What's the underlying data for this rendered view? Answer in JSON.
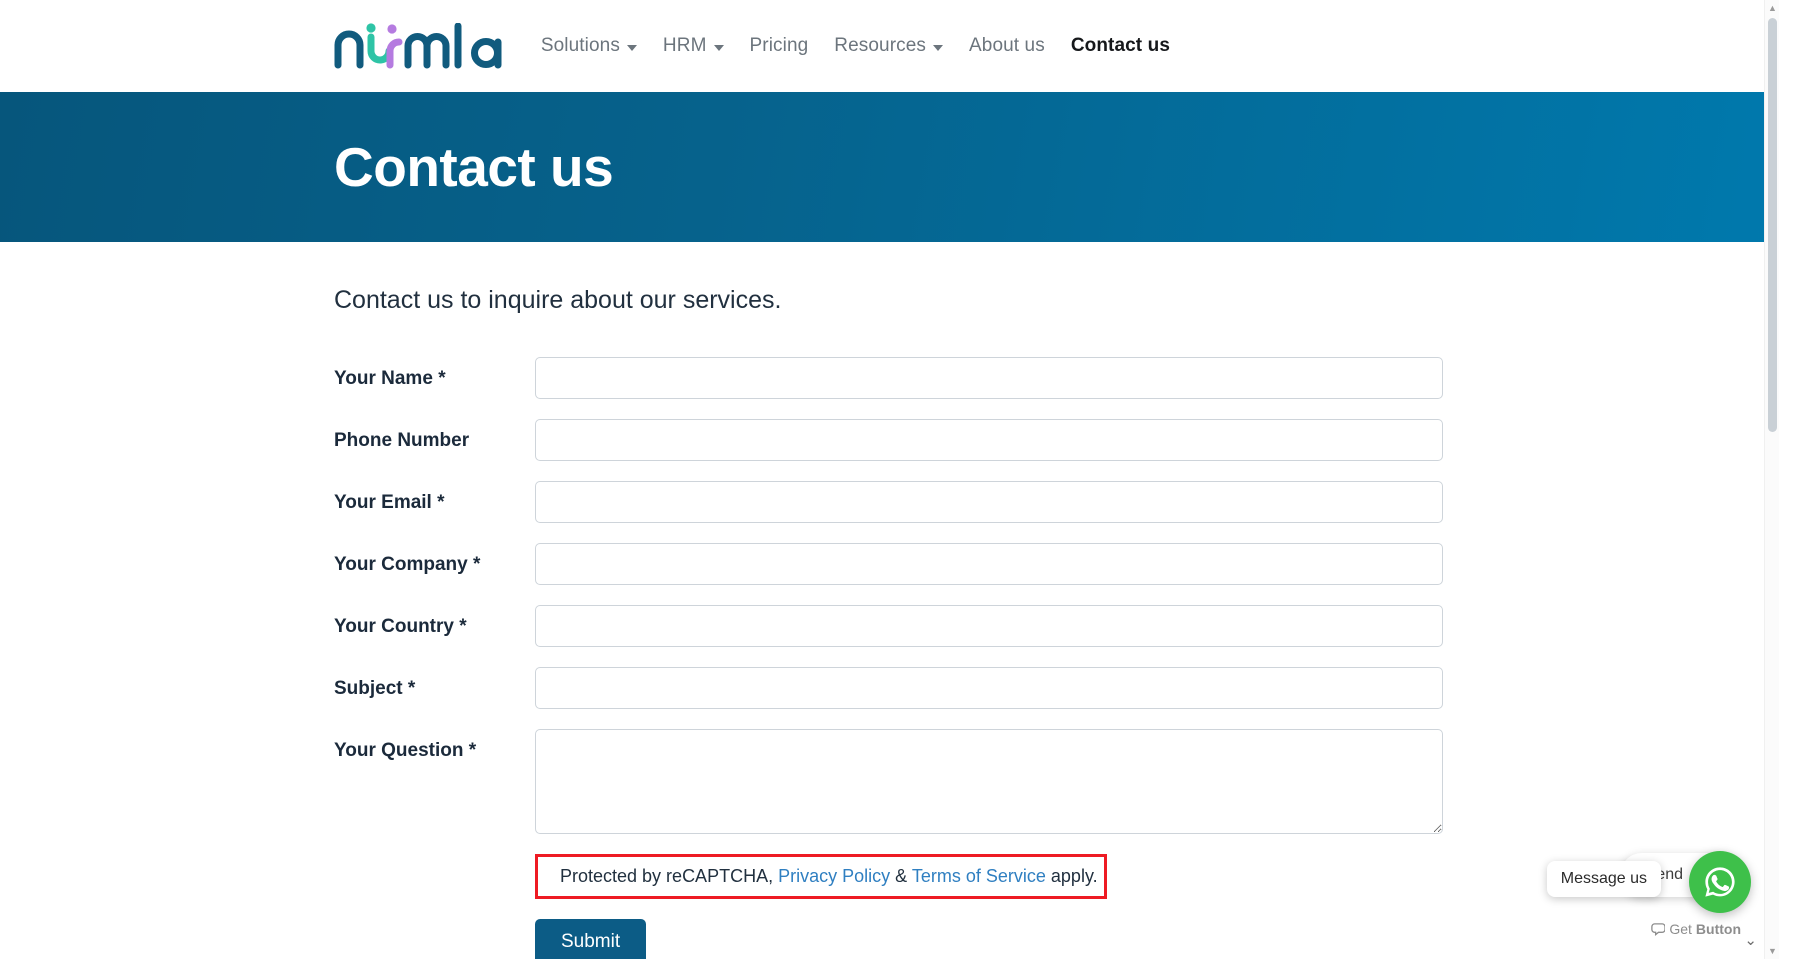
{
  "brand": {
    "logo_text": "numla",
    "logo_colors": {
      "wordmark": "#115b7e",
      "accent_teal": "#2ec4a6",
      "accent_purple": "#b57be0"
    }
  },
  "nav": {
    "items": [
      {
        "label": "Solutions",
        "has_dropdown": true,
        "active": false
      },
      {
        "label": "HRM",
        "has_dropdown": true,
        "active": false
      },
      {
        "label": "Pricing",
        "has_dropdown": false,
        "active": false
      },
      {
        "label": "Resources",
        "has_dropdown": true,
        "active": false
      },
      {
        "label": "About us",
        "has_dropdown": false,
        "active": false
      },
      {
        "label": "Contact us",
        "has_dropdown": false,
        "active": true
      }
    ]
  },
  "hero": {
    "title": "Contact us",
    "bg_from": "#06567c",
    "bg_to": "#0079ad"
  },
  "main": {
    "intro": "Contact us to inquire about our services.",
    "form": {
      "fields": [
        {
          "label": "Your Name",
          "required": true,
          "value": "",
          "placeholder": "",
          "type": "text"
        },
        {
          "label": "Phone Number",
          "required": false,
          "value": "",
          "placeholder": "",
          "type": "text"
        },
        {
          "label": "Your Email",
          "required": true,
          "value": "",
          "placeholder": "",
          "type": "text"
        },
        {
          "label": "Your Company",
          "required": true,
          "value": "",
          "placeholder": "",
          "type": "text"
        },
        {
          "label": "Your Country",
          "required": true,
          "value": "",
          "placeholder": "",
          "type": "text"
        },
        {
          "label": "Subject",
          "required": true,
          "value": "",
          "placeholder": "",
          "type": "text"
        },
        {
          "label": "Your Question",
          "required": true,
          "value": "",
          "placeholder": "",
          "type": "textarea"
        }
      ],
      "required_marker": "*",
      "submit_label": "Submit",
      "submit_color": "#0c5c86"
    },
    "recaptcha": {
      "prefix": "Protected by reCAPTCHA,",
      "privacy_link": "Privacy Policy",
      "separator": "&",
      "terms_link": "Terms of Service",
      "suffix": "apply.",
      "highlight_color": "#ee1b23",
      "link_color": "#2f7fc1"
    }
  },
  "chat_widget": {
    "pill_label": "ckend",
    "tooltip_label": "Message us",
    "brand_prefix": "Get",
    "brand_suffix": "Button",
    "whatsapp_color": "#3ec04a",
    "collapse_icon": "chevron-down"
  },
  "scrollbar": {
    "up_arrow": "⌃",
    "down_arrow": "⌄"
  }
}
